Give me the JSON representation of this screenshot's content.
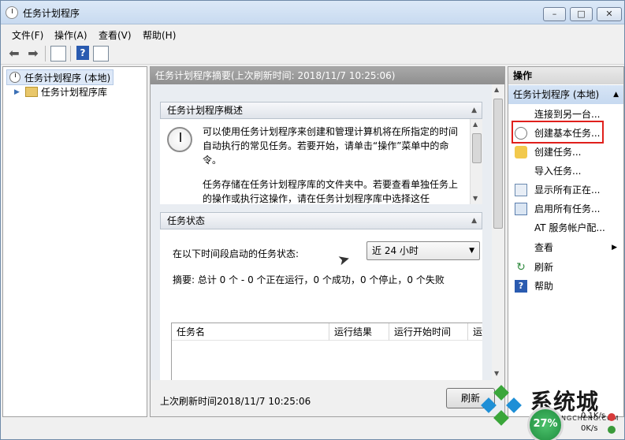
{
  "window": {
    "title": "任务计划程序",
    "minimize": "–",
    "maximize": "□",
    "close": "✕"
  },
  "menu": [
    "文件(F)",
    "操作(A)",
    "查看(V)",
    "帮助(H)"
  ],
  "tree": {
    "root": "任务计划程序 (本地)",
    "child": "任务计划程序库"
  },
  "center": {
    "header": "任务计划程序摘要(上次刷新时间: 2018/11/7 10:25:06)",
    "overview_title": "任务计划程序概述",
    "overview_p1": "可以使用任务计划程序来创建和管理计算机将在所指定的时间自动执行的常见任务。若要开始，请单击“操作”菜单中的命令。",
    "overview_p2": "任务存储在任务计划程序库的文件夹中。若要查看单独任务上的操作或执行这操作，请在任务计划程序库中选择这任",
    "status_title": "任务状态",
    "status_label": "在以下时间段启动的任务状态:",
    "dropdown_value": "近 24 小时",
    "summary": "摘要: 总计 0 个 - 0 个正在运行，0 个成功，0 个停止，0 个失败",
    "table_columns": [
      "任务名",
      "运行结果",
      "运行开始时间",
      "运"
    ],
    "footer": "上次刷新时间2018/11/7 10:25:06",
    "refresh_button": "刷新"
  },
  "actions": {
    "header": "操作",
    "group": "任务计划程序 (本地)",
    "items": [
      {
        "label": "连接到另一台...",
        "icon": "none"
      },
      {
        "label": "创建基本任务...",
        "icon": "clock-icon"
      },
      {
        "label": "创建任务...",
        "icon": "new-task-icon"
      },
      {
        "label": "导入任务...",
        "icon": "none"
      },
      {
        "label": "显示所有正在...",
        "icon": "list-icon"
      },
      {
        "label": "启用所有任务...",
        "icon": "enable-icon"
      },
      {
        "label": "AT 服务帐户配...",
        "icon": "none"
      },
      {
        "label": "查看",
        "icon": "none"
      },
      {
        "label": "刷新",
        "icon": "refresh-icon"
      },
      {
        "label": "帮助",
        "icon": "help-icon"
      }
    ]
  },
  "overlay": {
    "brand": "系统城",
    "brand_sub": "XITONGCHENG.COM",
    "gauge": "27%",
    "net_up": "0.1K/s",
    "net_down": "0K/s"
  },
  "colors": {
    "highlight": "#e0201c",
    "selected": "#dde8f7",
    "header_gray": "#8f8f8f"
  }
}
